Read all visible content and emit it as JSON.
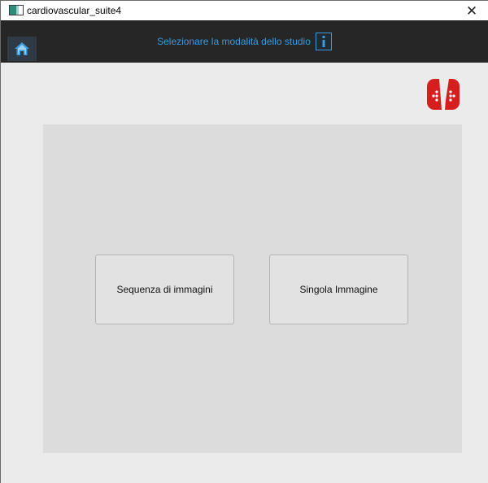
{
  "window": {
    "title": "cardiovascular_suite4",
    "close_glyph": "✕"
  },
  "toolbar": {
    "home_icon": "home-icon",
    "mode_title": "Selezionare la modalità dello studio",
    "info_icon": "info-icon",
    "accent_color": "#3a9be0",
    "background_color": "#262626"
  },
  "logo": {
    "icon": "app-logo",
    "color": "#d71e1e"
  },
  "main": {
    "buttons": [
      {
        "label": "Sequenza di immagini"
      },
      {
        "label": "Singola Immagine"
      }
    ]
  }
}
